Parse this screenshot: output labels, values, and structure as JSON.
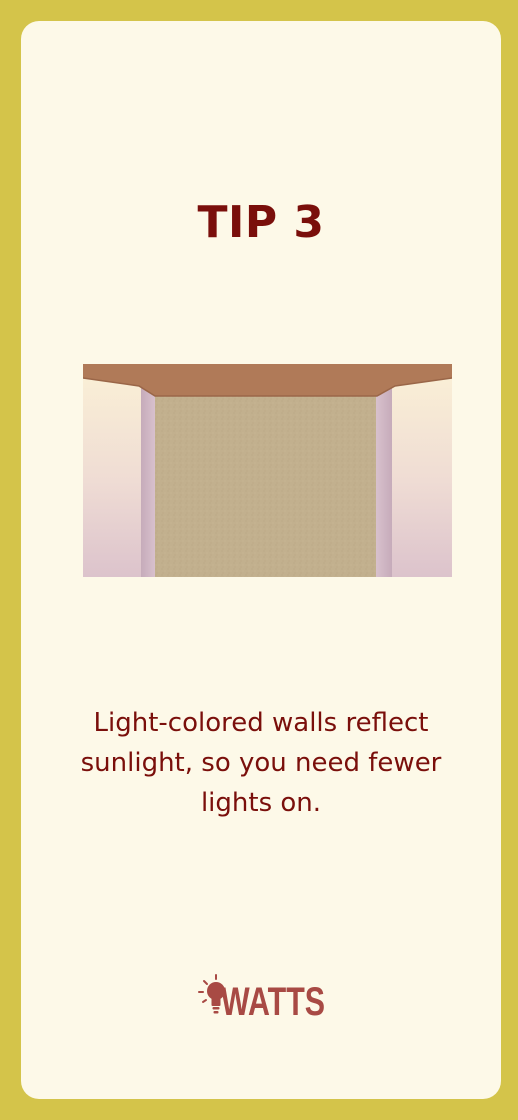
{
  "card": {
    "title": "TIP 3",
    "illustration": "room-with-light-walls",
    "text": "Light-colored walls reflect sunlight, so you need fewer lights on."
  },
  "brand": {
    "logo_text": "WATTS",
    "logo_icon": "lightbulb-icon"
  },
  "colors": {
    "page_border": "#d4c44a",
    "card_background": "#fdf9e8",
    "heading": "#7a0f0b",
    "logo": "#a84a44",
    "ceiling": "#b07a58",
    "back_wall": "#c2b08e"
  }
}
